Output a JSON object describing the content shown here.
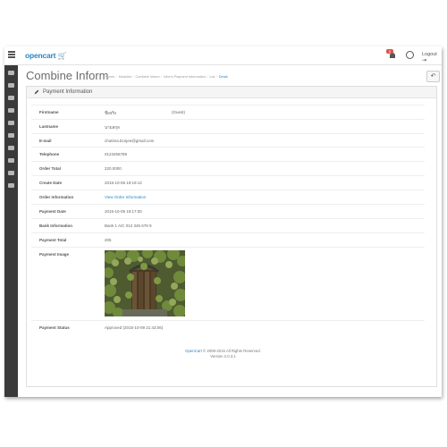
{
  "topbar": {
    "logo_text": "opencart",
    "logo_cart": "⇌",
    "notification_count": "0",
    "logout_label": "Logout",
    "logout_icon": "logout-icon"
  },
  "sidebar": {
    "icons": [
      "dashboard-icon",
      "tag-icon",
      "puzzle-icon",
      "cart-icon",
      "user-icon",
      "share-icon",
      "wrench-icon",
      "chart-icon",
      "wallet-icon",
      "bank-icon"
    ]
  },
  "header": {
    "title": "Combine Inform",
    "breadcrumb": [
      "Home",
      "Modules",
      "Combine Inform",
      "Inform Payment Information",
      "List",
      "Detail"
    ],
    "back_icon": "back-arrow-icon"
  },
  "panel": {
    "title": "Payment Information",
    "rows": [
      {
        "label": "Firstname",
        "value": "ชื่อจริง",
        "extra": "(Guest)"
      },
      {
        "label": "Lastname",
        "value": "นามสกุล",
        "extra": ""
      },
      {
        "label": "E-mail",
        "value": "chutima.bcnjee@gmail.com",
        "extra": ""
      },
      {
        "label": "Telephone",
        "value": "0123456789",
        "extra": ""
      },
      {
        "label": "Order Total",
        "value": "220.0000",
        "extra": ""
      },
      {
        "label": "Create Date",
        "value": "2015-10-08 19:19:12",
        "extra": ""
      },
      {
        "label": "Order Information",
        "value": "View Order Information",
        "extra": ""
      },
      {
        "label": "Payment Date",
        "value": "2015-10-09 19:17:00",
        "extra": ""
      },
      {
        "label": "Bank Information",
        "value": "Bank 1 A/C 012 345 678 9",
        "extra": ""
      },
      {
        "label": "Payment Total",
        "value": "205",
        "extra": ""
      },
      {
        "label": "Payment Image",
        "value": "",
        "extra": ""
      },
      {
        "label": "Payment Status",
        "value": "Approved (2015-10-09 21:43:06)",
        "extra": ""
      }
    ]
  },
  "footer": {
    "link": "OpenCart",
    "copyright": " © 2009-2015 All Rights Reserved.",
    "version": "Version 2.0.3.1"
  },
  "colors": {
    "accent": "#2a86c5",
    "sidebar": "#3a3a3a",
    "badge": "#d9534f"
  }
}
